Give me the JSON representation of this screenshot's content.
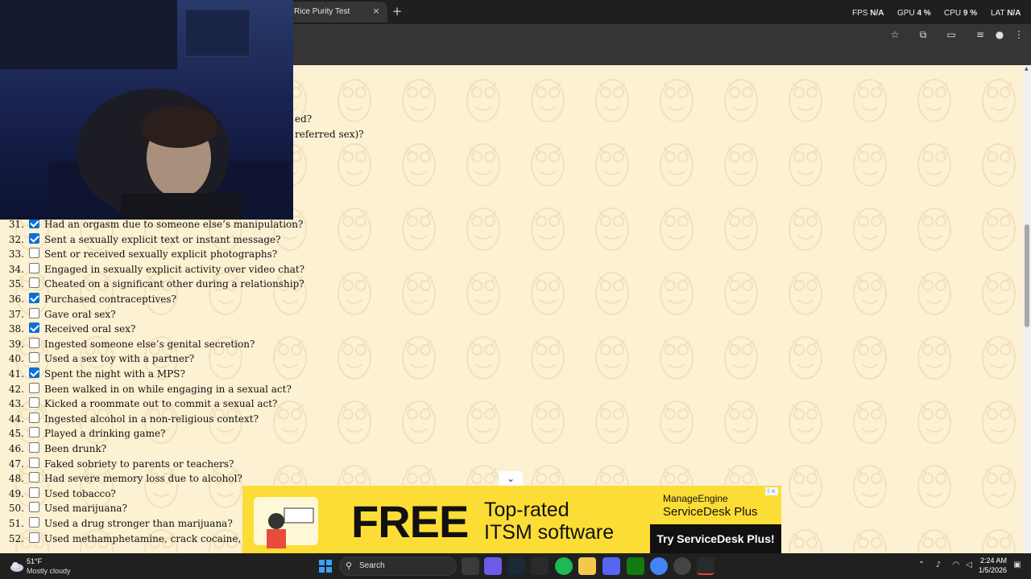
{
  "browser": {
    "tab_title": "Rice Purity Test",
    "tab_close": "×",
    "new_tab": "+"
  },
  "overlay": {
    "fps_label": "FPS",
    "fps_value": "N/A",
    "gpu_label": "GPU",
    "gpu_value": "4 %",
    "cpu_label": "CPU",
    "cpu_value": "9 %",
    "lat_label": "LAT",
    "lat_value": "N/A"
  },
  "partial_lines": [
    "ed?",
    "referred sex)?"
  ],
  "questions": [
    {
      "num": "31.",
      "text": "Had an orgasm due to someone else’s manipulation?",
      "checked": true
    },
    {
      "num": "32.",
      "text": "Sent a sexually explicit text or instant message?",
      "checked": true
    },
    {
      "num": "33.",
      "text": "Sent or received sexually explicit photographs?",
      "checked": false
    },
    {
      "num": "34.",
      "text": "Engaged in sexually explicit activity over video chat?",
      "checked": false
    },
    {
      "num": "35.",
      "text": "Cheated on a significant other during a relationship?",
      "checked": false
    },
    {
      "num": "36.",
      "text": "Purchased contraceptives?",
      "checked": true
    },
    {
      "num": "37.",
      "text": "Gave oral sex?",
      "checked": false
    },
    {
      "num": "38.",
      "text": "Received oral sex?",
      "checked": true
    },
    {
      "num": "39.",
      "text": "Ingested someone else’s genital secretion?",
      "checked": false
    },
    {
      "num": "40.",
      "text": "Used a sex toy with a partner?",
      "checked": false
    },
    {
      "num": "41.",
      "text": "Spent the night with a MPS?",
      "checked": true
    },
    {
      "num": "42.",
      "text": "Been walked in on while engaging in a sexual act?",
      "checked": false
    },
    {
      "num": "43.",
      "text": "Kicked a roommate out to commit a sexual act?",
      "checked": false
    },
    {
      "num": "44.",
      "text": "Ingested alcohol in a non-religious context?",
      "checked": false
    },
    {
      "num": "45.",
      "text": "Played a drinking game?",
      "checked": false
    },
    {
      "num": "46.",
      "text": "Been drunk?",
      "checked": false
    },
    {
      "num": "47.",
      "text": "Faked sobriety to parents or teachers?",
      "checked": false
    },
    {
      "num": "48.",
      "text": "Had severe memory loss due to alcohol?",
      "checked": false
    },
    {
      "num": "49.",
      "text": "Used tobacco?",
      "checked": false
    },
    {
      "num": "50.",
      "text": "Used marijuana?",
      "checked": false
    },
    {
      "num": "51.",
      "text": "Used a drug stronger than marijuana?",
      "checked": false
    },
    {
      "num": "52.",
      "text": "Used methamphetamine, crack cocaine, PCP, h",
      "checked": false
    }
  ],
  "ad": {
    "headline": "FREE",
    "line1": "Top-rated",
    "line2": "ITSM software",
    "brand1": "ManageEngine",
    "brand2": "ServiceDesk Plus",
    "cta": "Try ServiceDesk Plus!",
    "collapse": "⌄",
    "adchoices": "i ×"
  },
  "taskbar": {
    "temperature": "51°F",
    "weather": "Mostly cloudy",
    "search_placeholder": "Search",
    "time": "2:24 AM",
    "date": "1/5/2026"
  },
  "colors": {
    "page_bg": "#fdf1d3",
    "checkbox_checked": "#0b6fd8",
    "ad_bg": "#fcdd35"
  }
}
